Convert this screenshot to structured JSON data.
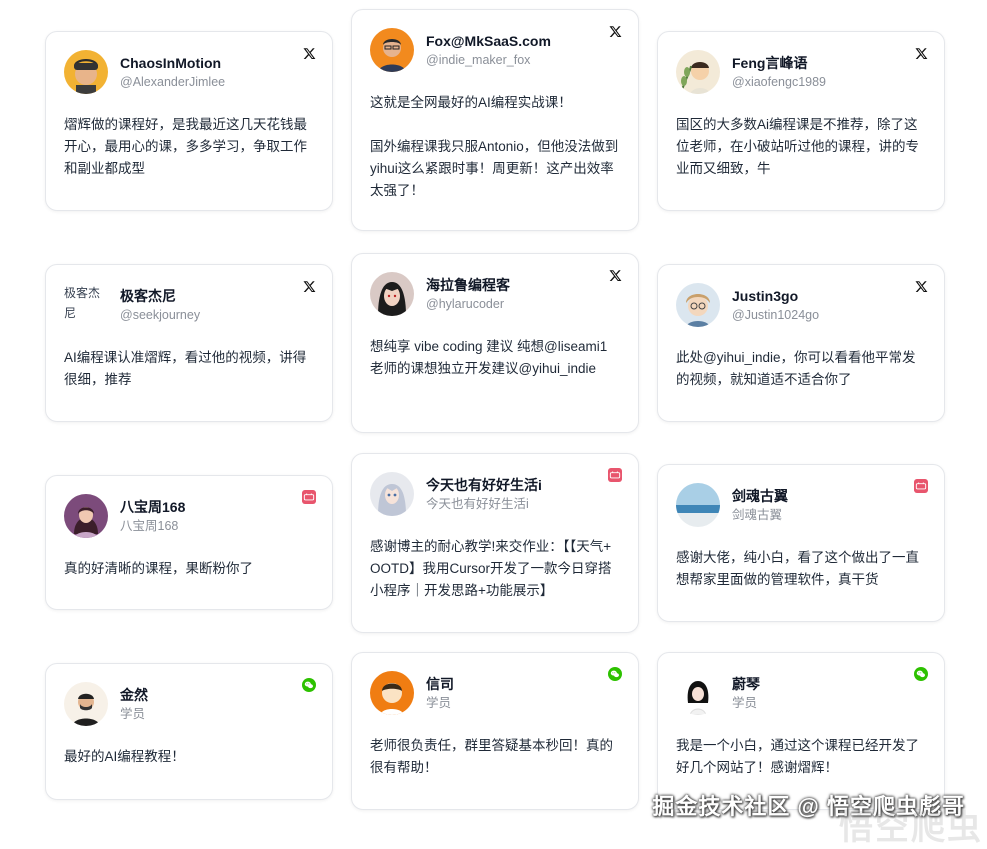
{
  "cards": [
    {
      "name": "ChaosInMotion",
      "handle": "@AlexanderJimlee",
      "platform": "x-icon",
      "avatar": "avatar-illustrated-boy",
      "text": "熠辉做的课程好，是我最近这几天花钱最开心，最用心的课，多多学习，争取工作和副业都成型"
    },
    {
      "name": "Fox@MkSaaS.com",
      "handle": "@indie_maker_fox",
      "platform": "x-icon",
      "avatar": "avatar-man-orange-bg",
      "text": "这就是全网最好的AI编程实战课！\n\n国外编程课我只服Antonio，但他没法做到yihui这么紧跟时事！周更新！这产出效率太强了！"
    },
    {
      "name": "Feng言峰语",
      "handle": "@xiaofengc1989",
      "platform": "x-icon",
      "avatar": "avatar-cartoon-plant",
      "text": "国区的大多数Ai编程课是不推荐，除了这位老师，在小破站听过他的课程，讲的专业而又细致，牛"
    },
    {
      "name": "极客杰尼",
      "handle": "@seekjourney",
      "platform": "x-icon",
      "avatar": "avatar-broken-image",
      "avatar_alt": "极客杰尼",
      "text": "AI编程课认准熠辉，看过他的视频，讲得很细，推荐"
    },
    {
      "name": "海拉鲁编程客",
      "handle": "@hylarucoder",
      "platform": "x-icon",
      "avatar": "avatar-anime-character",
      "text": "想纯享 vibe coding 建议 纯想@liseami1老师的课想独立开发建议@yihui_indie"
    },
    {
      "name": "Justin3go",
      "handle": "@Justin1024go",
      "platform": "x-icon",
      "avatar": "avatar-anime-boy",
      "text": "此处@yihui_indie，你可以看看他平常发的视频，就知道适不适合你了"
    },
    {
      "name": "八宝周168",
      "handle": "八宝周168",
      "platform": "xiaohongshu-icon",
      "avatar": "avatar-woman-purple",
      "text": "真的好清晰的课程，果断粉你了"
    },
    {
      "name": "今天也有好好生活i",
      "handle": "今天也有好好生活i",
      "platform": "xiaohongshu-icon",
      "avatar": "avatar-anime-girl",
      "text": "感谢博主的耐心教学!来交作业：【【天气+OOTD】我用Cursor开发了一款今日穿搭小程序｜开发思路+功能展示】"
    },
    {
      "name": "剑魂古翼",
      "handle": "剑魂古翼",
      "platform": "xiaohongshu-icon",
      "avatar": "avatar-ocean",
      "text": "感谢大佬，纯小白，看了这个做出了一直想帮家里面做的管理软件，真干货"
    },
    {
      "name": "金然",
      "handle": "学员",
      "platform": "wechat-icon",
      "avatar": "avatar-man-glasses",
      "text": "最好的AI编程教程！"
    },
    {
      "name": "信司",
      "handle": "学员",
      "platform": "wechat-icon",
      "avatar": "avatar-cartoon-orange",
      "text": "老师很负责任，群里答疑基本秒回！真的很有帮助！"
    },
    {
      "name": "蔚琴",
      "handle": "学员",
      "platform": "wechat-icon",
      "avatar": "avatar-cartoon-girl",
      "text": "我是一个小白，通过这个课程已经开发了好几个网站了！感谢熠辉！"
    }
  ],
  "watermark": "掘金技术社区 @ 悟空爬虫彪哥",
  "watermark_faint": "悟空爬虫",
  "colors": {
    "border": "#e5e7eb",
    "wechat": "#2dc100",
    "xiaohongshu": "#e8556d",
    "x": "#111111"
  }
}
